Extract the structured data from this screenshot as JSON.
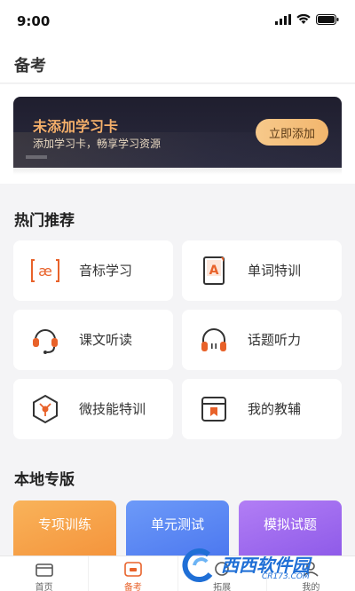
{
  "status_bar": {
    "time": "9:00"
  },
  "header": {
    "title": "备考"
  },
  "banner": {
    "title": "未添加学习卡",
    "subtitle": "添加学习卡，畅享学习资源",
    "button_label": "立即添加"
  },
  "hot": {
    "title": "热门推荐",
    "items": [
      {
        "label": "音标学习",
        "icon": "phonetic-ae-icon"
      },
      {
        "label": "单词特训",
        "icon": "word-card-icon"
      },
      {
        "label": "课文听读",
        "icon": "headset-mic-icon"
      },
      {
        "label": "话题听力",
        "icon": "headphones-icon"
      },
      {
        "label": "微技能特训",
        "icon": "hexagon-skill-icon"
      },
      {
        "label": "我的教辅",
        "icon": "book-icon"
      }
    ]
  },
  "local": {
    "title": "本地专版",
    "tiles": [
      {
        "label": "专项训练",
        "color": "#f7a54a"
      },
      {
        "label": "单元测试",
        "color": "#5b8cf7"
      },
      {
        "label": "模拟试题",
        "color": "#a06cf0"
      }
    ]
  },
  "tabbar": {
    "tabs": [
      {
        "label": "首页",
        "icon": "home-icon",
        "active": false
      },
      {
        "label": "备考",
        "icon": "exam-icon",
        "active": true
      },
      {
        "label": "拓展",
        "icon": "expand-icon",
        "active": false
      },
      {
        "label": "我的",
        "icon": "profile-icon",
        "active": false
      }
    ]
  },
  "watermark": {
    "text": "西西软件园",
    "sub": "CR173.COM"
  },
  "colors": {
    "accent": "#e8622a",
    "banner_gold": "#f5b06a"
  }
}
